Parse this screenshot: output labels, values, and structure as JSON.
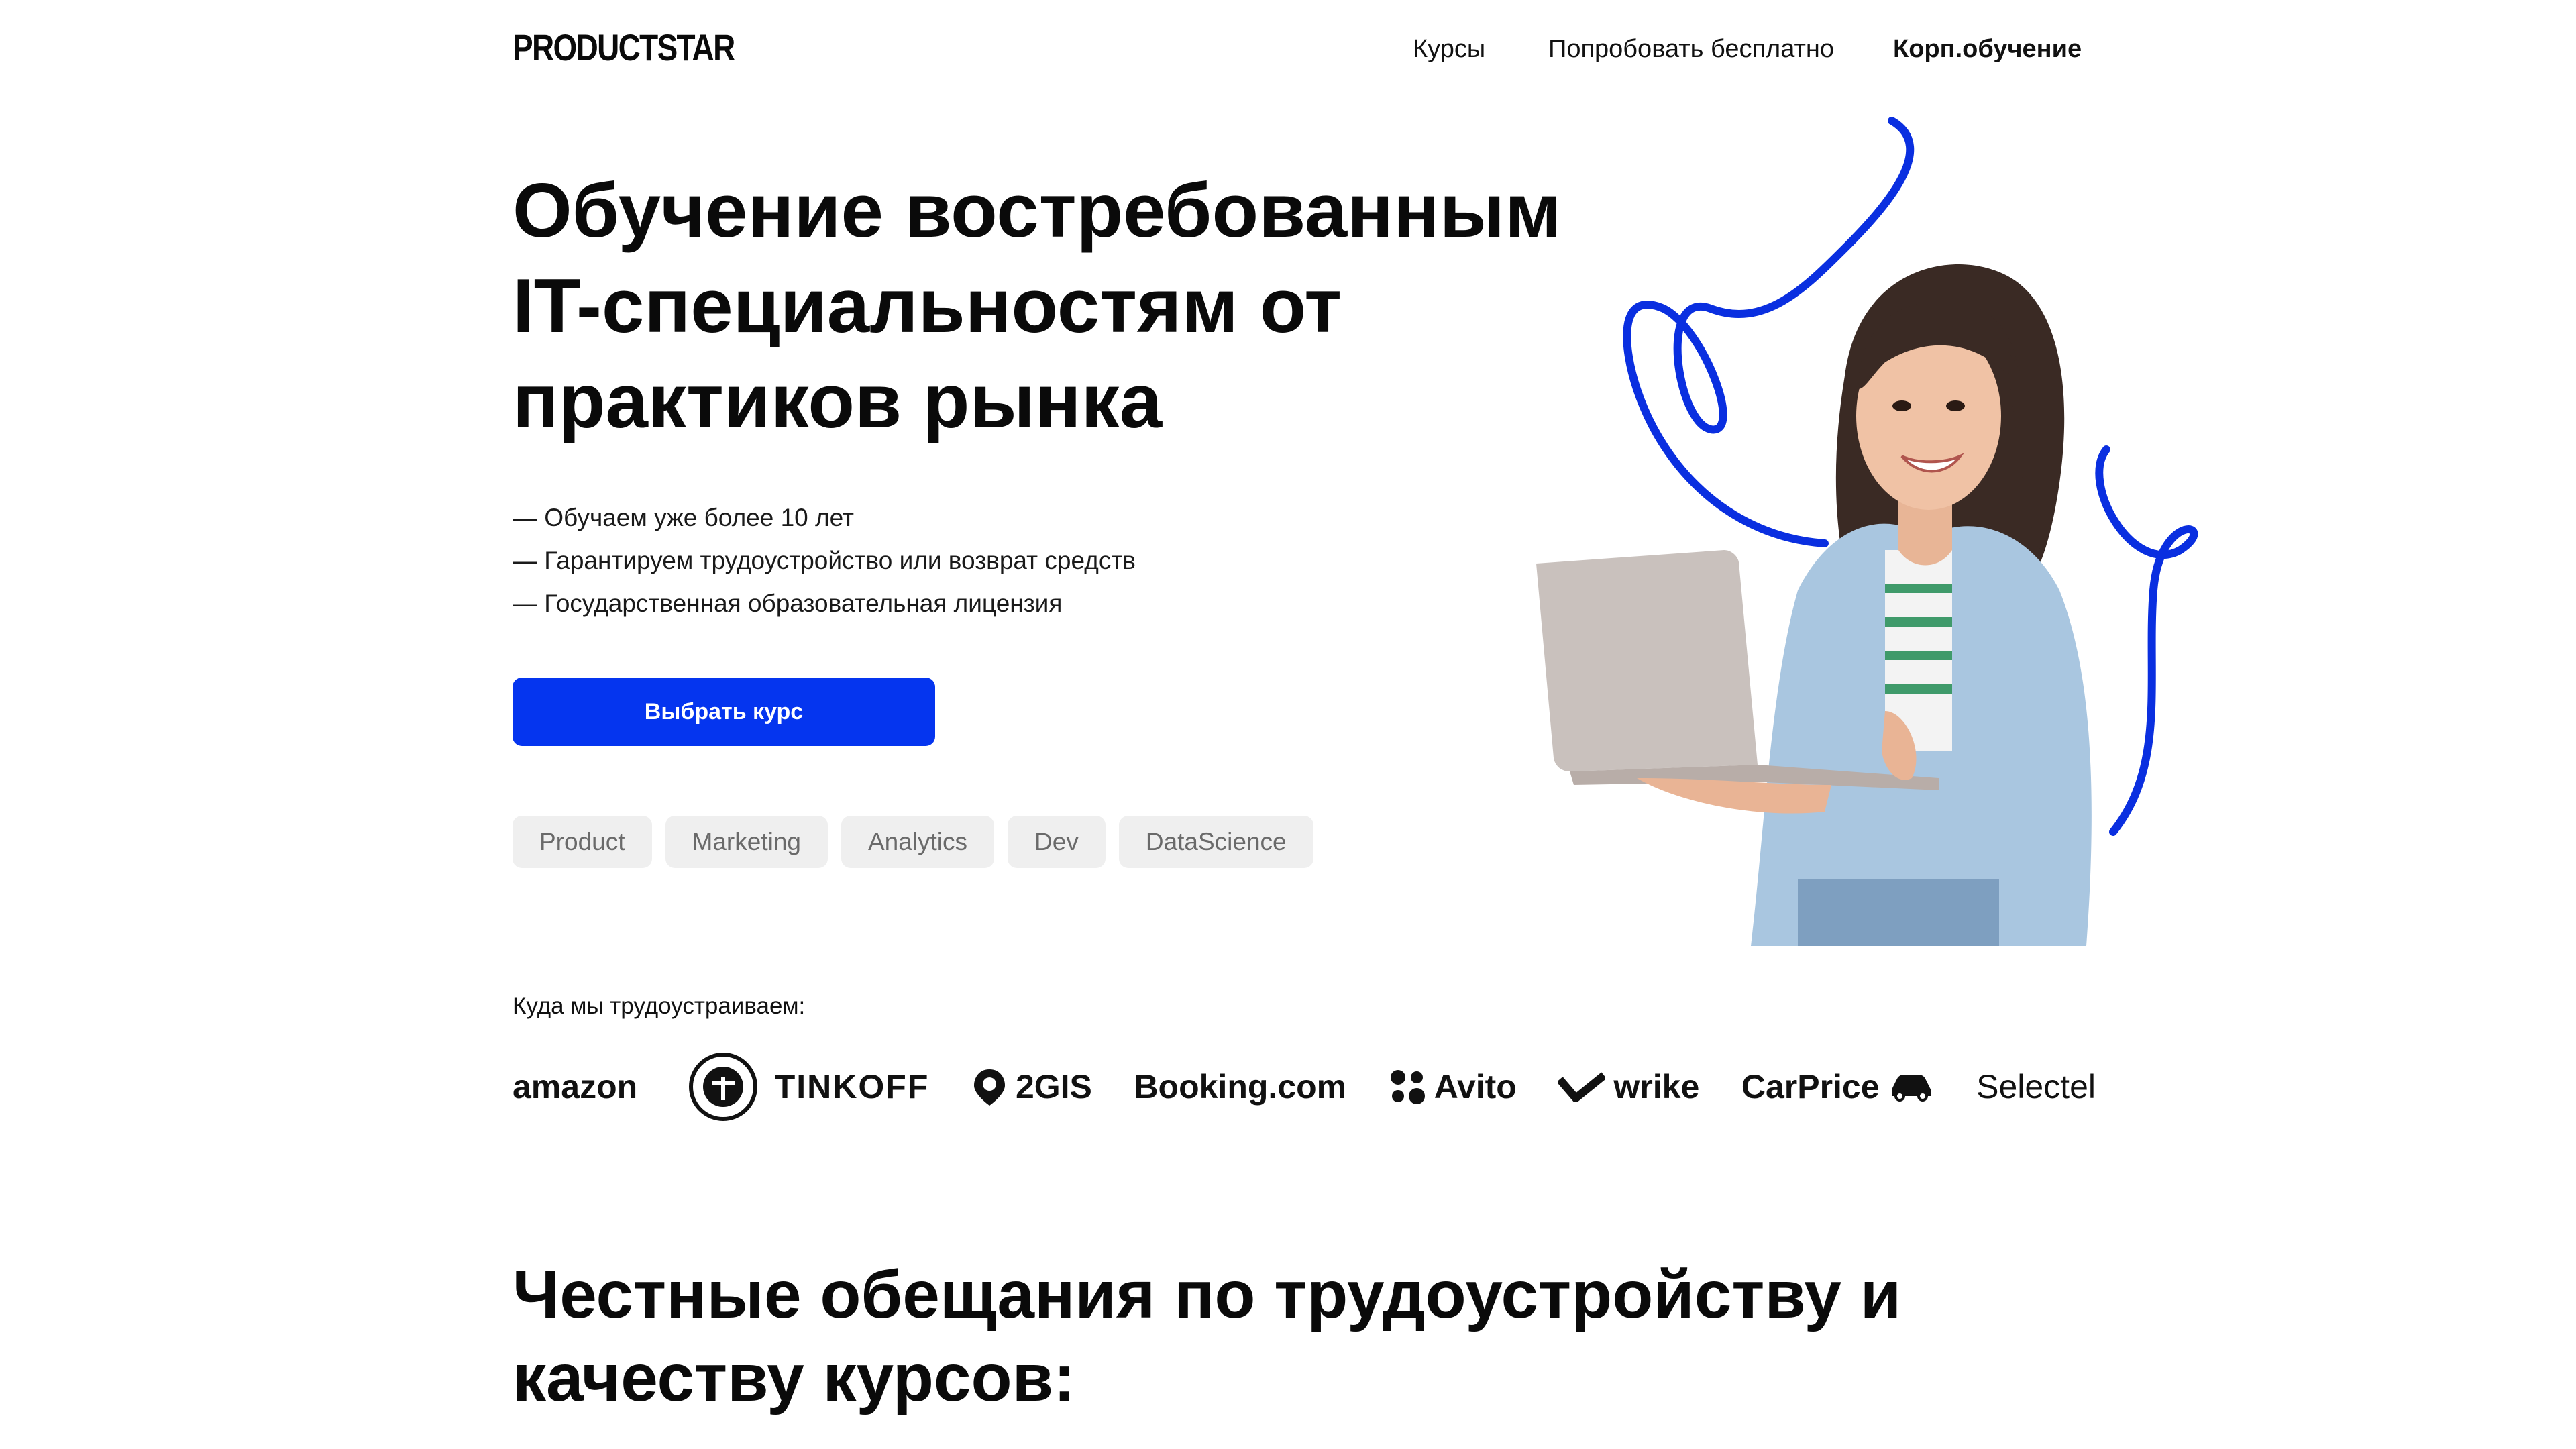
{
  "header": {
    "logo": "PRODUCTSTAR",
    "nav": [
      {
        "label": "Курсы"
      },
      {
        "label": "Попробовать бесплатно"
      },
      {
        "label": "Корп.обучение"
      }
    ]
  },
  "hero": {
    "title_lines": [
      "Обучение востребованным",
      "IT-специальностям от",
      "практиков рынка"
    ],
    "bullets": [
      "— Обучаем уже более 10 лет",
      "— Гарантируем трудоустройство или возврат средств",
      "— Государственная образовательная лицензия"
    ],
    "cta_label": "Выбрать курс",
    "tags": [
      "Product",
      "Marketing",
      "Analytics",
      "Dev",
      "DataScience"
    ]
  },
  "employers": {
    "label": "Куда мы трудоустраиваем:",
    "logos": [
      "amazon",
      "TINKOFF",
      "2GIS",
      "Booking.com",
      "Avito",
      "wrike",
      "CarPrice",
      "Selectel"
    ]
  },
  "section": {
    "title_lines": [
      "Честные обещания по трудоустройству и",
      "качеству курсов:"
    ]
  },
  "colors": {
    "accent": "#0535ef",
    "tag_bg": "#efefef",
    "tag_text": "#6a6a6a"
  }
}
